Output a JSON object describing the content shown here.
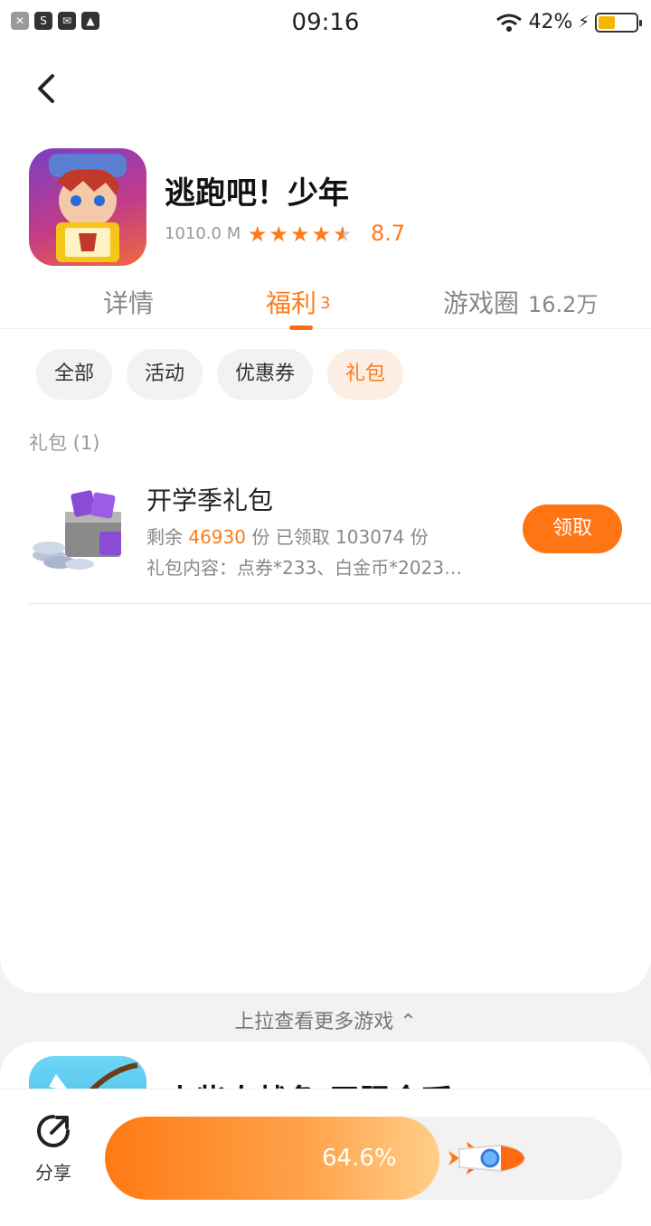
{
  "status_bar": {
    "time": "09:16",
    "battery": "42%",
    "left_icons": [
      "x-app-icon",
      "s-app-icon",
      "mail-icon",
      "image-icon"
    ]
  },
  "app": {
    "title": "逃跑吧！少年",
    "size": "1010.0 M",
    "rating": "8.7",
    "stars": 4.5
  },
  "tabs": [
    {
      "label": "详情"
    },
    {
      "label": "福利",
      "badge": "3"
    },
    {
      "label": "游戏圈",
      "count": "16.2万"
    }
  ],
  "filters": [
    {
      "label": "全部"
    },
    {
      "label": "活动"
    },
    {
      "label": "优惠券"
    },
    {
      "label": "礼包",
      "active": true
    }
  ],
  "section": {
    "label": "礼包 (1)"
  },
  "gift": {
    "name": "开学季礼包",
    "remaining_prefix": "剩余 ",
    "remaining": "46930",
    "remaining_suffix": " 份 已领取 103074 份",
    "content": "礼包内容：点券*233、白金币*2023…",
    "claim_label": "领取"
  },
  "pull_hint": "上拉查看更多游戏",
  "next_game": {
    "title": "火柴人战争 无限金币"
  },
  "bottom": {
    "share_label": "分享",
    "progress_text": "64.6%",
    "progress_value": 0.646
  },
  "colors": {
    "accent": "#ff7413",
    "battery": "#f4b800"
  }
}
